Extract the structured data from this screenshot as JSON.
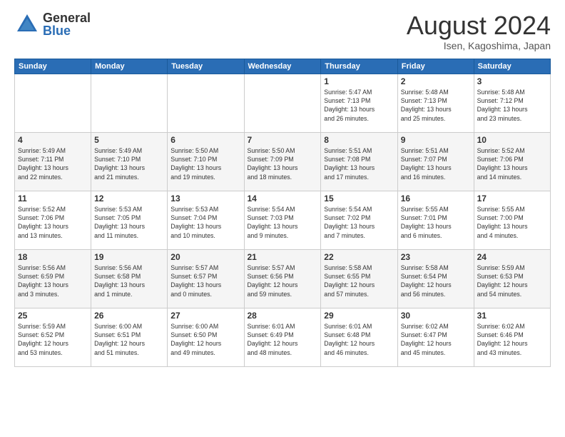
{
  "header": {
    "logo_general": "General",
    "logo_blue": "Blue",
    "month_title": "August 2024",
    "location": "Isen, Kagoshima, Japan"
  },
  "days_of_week": [
    "Sunday",
    "Monday",
    "Tuesday",
    "Wednesday",
    "Thursday",
    "Friday",
    "Saturday"
  ],
  "weeks": [
    [
      {
        "day": "",
        "info": ""
      },
      {
        "day": "",
        "info": ""
      },
      {
        "day": "",
        "info": ""
      },
      {
        "day": "",
        "info": ""
      },
      {
        "day": "1",
        "info": "Sunrise: 5:47 AM\nSunset: 7:13 PM\nDaylight: 13 hours\nand 26 minutes."
      },
      {
        "day": "2",
        "info": "Sunrise: 5:48 AM\nSunset: 7:13 PM\nDaylight: 13 hours\nand 25 minutes."
      },
      {
        "day": "3",
        "info": "Sunrise: 5:48 AM\nSunset: 7:12 PM\nDaylight: 13 hours\nand 23 minutes."
      }
    ],
    [
      {
        "day": "4",
        "info": "Sunrise: 5:49 AM\nSunset: 7:11 PM\nDaylight: 13 hours\nand 22 minutes."
      },
      {
        "day": "5",
        "info": "Sunrise: 5:49 AM\nSunset: 7:10 PM\nDaylight: 13 hours\nand 21 minutes."
      },
      {
        "day": "6",
        "info": "Sunrise: 5:50 AM\nSunset: 7:10 PM\nDaylight: 13 hours\nand 19 minutes."
      },
      {
        "day": "7",
        "info": "Sunrise: 5:50 AM\nSunset: 7:09 PM\nDaylight: 13 hours\nand 18 minutes."
      },
      {
        "day": "8",
        "info": "Sunrise: 5:51 AM\nSunset: 7:08 PM\nDaylight: 13 hours\nand 17 minutes."
      },
      {
        "day": "9",
        "info": "Sunrise: 5:51 AM\nSunset: 7:07 PM\nDaylight: 13 hours\nand 16 minutes."
      },
      {
        "day": "10",
        "info": "Sunrise: 5:52 AM\nSunset: 7:06 PM\nDaylight: 13 hours\nand 14 minutes."
      }
    ],
    [
      {
        "day": "11",
        "info": "Sunrise: 5:52 AM\nSunset: 7:06 PM\nDaylight: 13 hours\nand 13 minutes."
      },
      {
        "day": "12",
        "info": "Sunrise: 5:53 AM\nSunset: 7:05 PM\nDaylight: 13 hours\nand 11 minutes."
      },
      {
        "day": "13",
        "info": "Sunrise: 5:53 AM\nSunset: 7:04 PM\nDaylight: 13 hours\nand 10 minutes."
      },
      {
        "day": "14",
        "info": "Sunrise: 5:54 AM\nSunset: 7:03 PM\nDaylight: 13 hours\nand 9 minutes."
      },
      {
        "day": "15",
        "info": "Sunrise: 5:54 AM\nSunset: 7:02 PM\nDaylight: 13 hours\nand 7 minutes."
      },
      {
        "day": "16",
        "info": "Sunrise: 5:55 AM\nSunset: 7:01 PM\nDaylight: 13 hours\nand 6 minutes."
      },
      {
        "day": "17",
        "info": "Sunrise: 5:55 AM\nSunset: 7:00 PM\nDaylight: 13 hours\nand 4 minutes."
      }
    ],
    [
      {
        "day": "18",
        "info": "Sunrise: 5:56 AM\nSunset: 6:59 PM\nDaylight: 13 hours\nand 3 minutes."
      },
      {
        "day": "19",
        "info": "Sunrise: 5:56 AM\nSunset: 6:58 PM\nDaylight: 13 hours\nand 1 minute."
      },
      {
        "day": "20",
        "info": "Sunrise: 5:57 AM\nSunset: 6:57 PM\nDaylight: 13 hours\nand 0 minutes."
      },
      {
        "day": "21",
        "info": "Sunrise: 5:57 AM\nSunset: 6:56 PM\nDaylight: 12 hours\nand 59 minutes."
      },
      {
        "day": "22",
        "info": "Sunrise: 5:58 AM\nSunset: 6:55 PM\nDaylight: 12 hours\nand 57 minutes."
      },
      {
        "day": "23",
        "info": "Sunrise: 5:58 AM\nSunset: 6:54 PM\nDaylight: 12 hours\nand 56 minutes."
      },
      {
        "day": "24",
        "info": "Sunrise: 5:59 AM\nSunset: 6:53 PM\nDaylight: 12 hours\nand 54 minutes."
      }
    ],
    [
      {
        "day": "25",
        "info": "Sunrise: 5:59 AM\nSunset: 6:52 PM\nDaylight: 12 hours\nand 53 minutes."
      },
      {
        "day": "26",
        "info": "Sunrise: 6:00 AM\nSunset: 6:51 PM\nDaylight: 12 hours\nand 51 minutes."
      },
      {
        "day": "27",
        "info": "Sunrise: 6:00 AM\nSunset: 6:50 PM\nDaylight: 12 hours\nand 49 minutes."
      },
      {
        "day": "28",
        "info": "Sunrise: 6:01 AM\nSunset: 6:49 PM\nDaylight: 12 hours\nand 48 minutes."
      },
      {
        "day": "29",
        "info": "Sunrise: 6:01 AM\nSunset: 6:48 PM\nDaylight: 12 hours\nand 46 minutes."
      },
      {
        "day": "30",
        "info": "Sunrise: 6:02 AM\nSunset: 6:47 PM\nDaylight: 12 hours\nand 45 minutes."
      },
      {
        "day": "31",
        "info": "Sunrise: 6:02 AM\nSunset: 6:46 PM\nDaylight: 12 hours\nand 43 minutes."
      }
    ]
  ]
}
